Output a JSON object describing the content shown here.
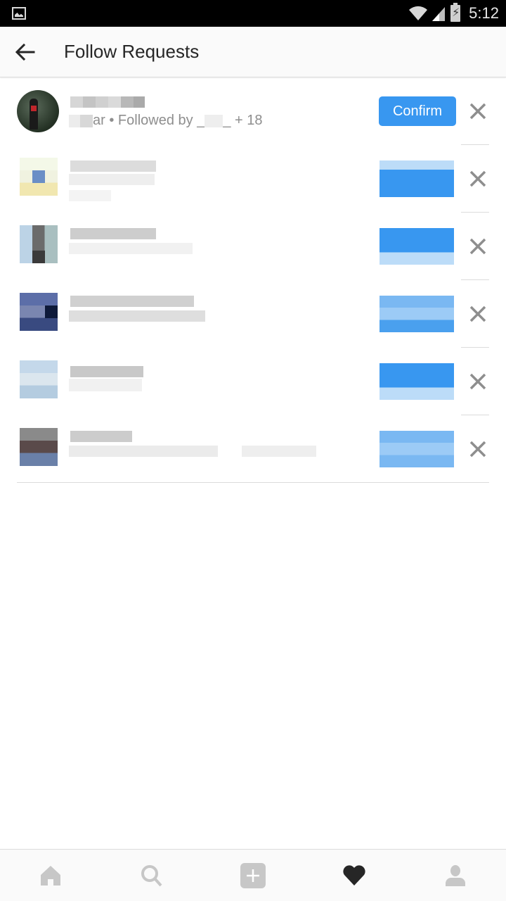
{
  "status_bar": {
    "time": "5:12",
    "icons": [
      "gallery-icon",
      "wifi-icon",
      "signal-icon",
      "battery-charging-icon"
    ]
  },
  "header": {
    "back_icon": "arrow-left-icon",
    "title": "Follow Requests"
  },
  "requests": [
    {
      "username": "",
      "subtitle_prefix": "ar",
      "subtitle_followed_by": " • Followed by ",
      "subtitle_suffix": "_ + 18",
      "confirm_label": "Confirm",
      "dismiss_icon": "close-icon",
      "obscured": false
    },
    {
      "username": "",
      "subtitle": "",
      "confirm_label": "",
      "dismiss_icon": "close-icon",
      "obscured": true
    },
    {
      "username": "",
      "subtitle": "",
      "confirm_label": "",
      "dismiss_icon": "close-icon",
      "obscured": true
    },
    {
      "username": "",
      "subtitle": "",
      "confirm_label": "",
      "dismiss_icon": "close-icon",
      "obscured": true
    },
    {
      "username": "",
      "subtitle": "",
      "confirm_label": "",
      "dismiss_icon": "close-icon",
      "obscured": true
    },
    {
      "username": "",
      "subtitle": "",
      "confirm_label": "",
      "dismiss_icon": "close-icon",
      "obscured": true
    }
  ],
  "tab_bar": {
    "tabs": [
      {
        "icon": "home-icon",
        "active": false
      },
      {
        "icon": "search-icon",
        "active": false
      },
      {
        "icon": "add-post-icon",
        "active": false
      },
      {
        "icon": "heart-icon",
        "active": true
      },
      {
        "icon": "profile-icon",
        "active": false
      }
    ]
  },
  "colors": {
    "accent": "#3897f0",
    "text_primary": "#262626",
    "text_secondary": "#8e8e8e",
    "icon_inactive": "#c7c7c7",
    "icon_active": "#262626"
  }
}
